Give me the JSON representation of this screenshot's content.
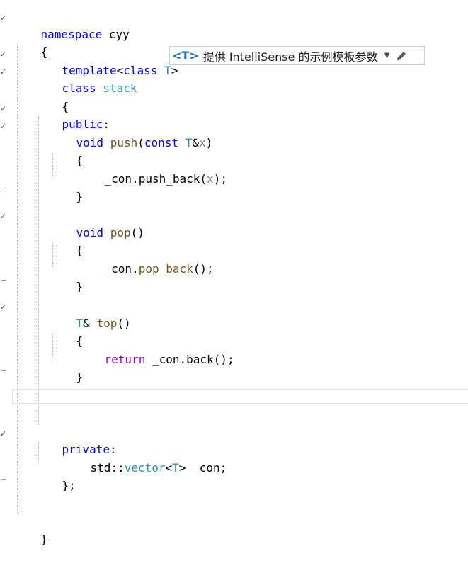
{
  "editor": {
    "language": "C++",
    "lines": {
      "l1": [
        "namespace",
        " ",
        "cyy"
      ],
      "l2": [
        "{"
      ],
      "l3": [
        "template",
        "<",
        "class",
        " ",
        "T",
        ">"
      ],
      "l4": [
        "class",
        " ",
        "stack"
      ],
      "l5": [
        "{"
      ],
      "l6": [
        "public",
        ":"
      ],
      "l7": [
        "void",
        " ",
        "push",
        "(",
        "const",
        " ",
        "T",
        "&",
        "x",
        ")"
      ],
      "l8": [
        "{"
      ],
      "l9": [
        "_con",
        ".",
        "push_back",
        "(",
        "x",
        ")",
        ";"
      ],
      "l10": [
        "}"
      ],
      "l11": [
        "void",
        " ",
        "pop",
        "()"
      ],
      "l12": [
        "{"
      ],
      "l13": [
        "_con",
        ".",
        "pop_back",
        "()",
        ";"
      ],
      "l14": [
        "}"
      ],
      "l15": [
        "T",
        "&",
        " ",
        "top",
        "()"
      ],
      "l16": [
        "{"
      ],
      "l17": [
        "return",
        " ",
        "_con",
        ".",
        "back",
        "()",
        ";"
      ],
      "l18": [
        "}"
      ],
      "l19": [
        "private",
        ":"
      ],
      "l20": [
        "std",
        "::",
        "vector",
        "<",
        "T",
        ">",
        " ",
        "_con",
        ";"
      ],
      "l21": [
        "}",
        ";"
      ],
      "l22": [
        "}"
      ]
    }
  },
  "intellisense": {
    "badge": "<T>",
    "text": "提供 IntelliSense 的示例模板参数",
    "arrow_icon": "dropdown-arrow-icon",
    "edit_icon": "pencil-icon"
  },
  "colors": {
    "keyword": "#0000ff",
    "control_keyword": "#8f08c4",
    "type": "#2b91af",
    "function": "#74531f",
    "parameter": "#808080"
  }
}
